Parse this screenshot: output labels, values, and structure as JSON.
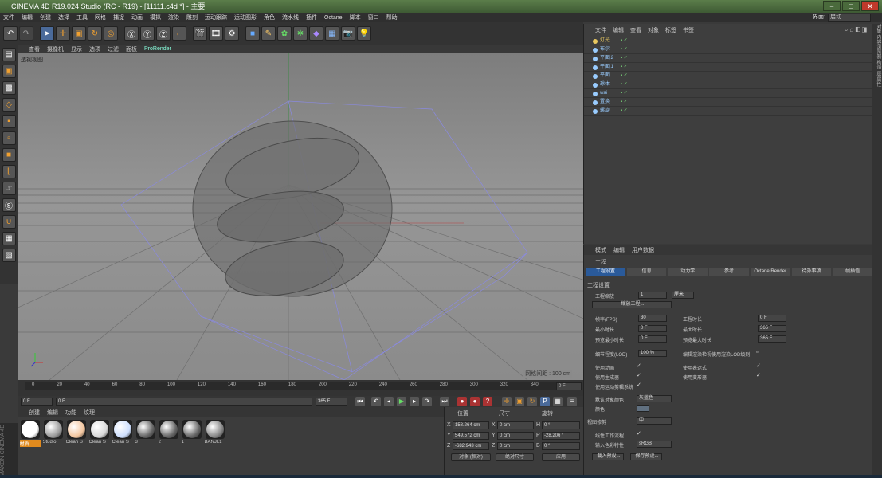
{
  "window": {
    "title": "CINEMA 4D R19.024 Studio (RC - R19) - [11111.c4d *] - 主要",
    "min": "−",
    "max": "□",
    "close": "✕"
  },
  "menubar": {
    "items": [
      "文件",
      "编辑",
      "创建",
      "选择",
      "工具",
      "网格",
      "捕捉",
      "动画",
      "模拟",
      "渲染",
      "雕刻",
      "运动跟踪",
      "运动图形",
      "角色",
      "流水线",
      "插件",
      "Octane",
      "脚本",
      "窗口",
      "帮助"
    ],
    "layout_label": "界面:",
    "layout_value": "启动"
  },
  "toolbar_icons": [
    "undo-icon",
    "redo-icon",
    "select-icon",
    "move-icon",
    "scale-icon",
    "rotate-icon",
    "live-select-icon",
    "x-axis-icon",
    "y-axis-icon",
    "z-axis-icon",
    "coord-system-icon",
    "render-view-icon",
    "render-picture-icon",
    "render-settings-icon",
    "cube-icon",
    "pen-icon",
    "subdivision-icon",
    "cloner-icon",
    "deformer-icon",
    "floor-icon",
    "camera-icon",
    "light-icon"
  ],
  "viewport": {
    "menu": [
      "查看",
      "摄像机",
      "显示",
      "选项",
      "过滤",
      "面板",
      "ProRender"
    ],
    "label": "透视视图",
    "grid_spacing": "网格间距 : 100 cm"
  },
  "timeline": {
    "ticks": [
      "0",
      "20",
      "40",
      "60",
      "80",
      "100",
      "120",
      "140",
      "160",
      "180",
      "200",
      "220",
      "240",
      "260",
      "280",
      "300",
      "320",
      "340",
      "360"
    ],
    "frame_field": "0 F"
  },
  "transport": {
    "start": "0 F",
    "current": "0 F",
    "end": "365 F",
    "end2": "365 F"
  },
  "materials": {
    "menu": [
      "创建",
      "编辑",
      "功能",
      "纹理"
    ],
    "items": [
      {
        "name": "材质",
        "color": "#ffffff",
        "selected": true
      },
      {
        "name": "Studio",
        "color": "#9a9a9a",
        "selected": false
      },
      {
        "name": "Clean S",
        "color": "#f4c7a0",
        "selected": false
      },
      {
        "name": "Clean S",
        "color": "#d8d8d8",
        "selected": false
      },
      {
        "name": "Clean S",
        "color": "#cfe0ff",
        "selected": false
      },
      {
        "name": "3",
        "color": "#666666",
        "selected": false
      },
      {
        "name": "2",
        "color": "#666666",
        "selected": false
      },
      {
        "name": "1",
        "color": "#666666",
        "selected": false
      },
      {
        "name": "BANJI.1",
        "color": "#888888",
        "selected": false
      }
    ]
  },
  "coords": {
    "headers": [
      "位置",
      "尺寸",
      "旋转"
    ],
    "rows": [
      {
        "axis": "X",
        "pos": "158.264 cm",
        "size_axis": "X",
        "size": "0 cm",
        "rot_axis": "H",
        "rot": "0 °"
      },
      {
        "axis": "Y",
        "pos": "549.572 cm",
        "size_axis": "Y",
        "size": "0 cm",
        "rot_axis": "P",
        "rot": "-28.206 °"
      },
      {
        "axis": "Z",
        "pos": "-682.943 cm",
        "size_axis": "Z",
        "size": "0 cm",
        "rot_axis": "B",
        "rot": "0 °"
      }
    ],
    "mode1": "对象 (相对)",
    "mode2": "绝对尺寸",
    "apply": "应用"
  },
  "objects": {
    "menu": [
      "文件",
      "编辑",
      "查看",
      "对象",
      "标签",
      "书签"
    ],
    "rows": [
      {
        "name": "灯光",
        "color": "#e8c860"
      },
      {
        "name": "布尔",
        "color": "#9cf"
      },
      {
        "name": "平面.2",
        "color": "#9cf"
      },
      {
        "name": "平面.1",
        "color": "#9cf"
      },
      {
        "name": "平面",
        "color": "#9cf"
      },
      {
        "name": "球体",
        "color": "#9cf"
      },
      {
        "name": "wai",
        "color": "#9cf"
      },
      {
        "name": "置换",
        "color": "#9cf"
      },
      {
        "name": "螺旋",
        "color": "#9cf"
      }
    ]
  },
  "right_strip": "对象 内容浏览器 构造 层 属性",
  "attributes": {
    "menu": [
      "模式",
      "编辑",
      "用户数据"
    ],
    "title": "工程",
    "tabs": [
      "工程设置",
      "信息",
      "动力学",
      "参考",
      "Octane Render",
      "待办事项",
      "帧插值"
    ],
    "section": "工程设置",
    "scale_label": "工程缩放",
    "scale_value": "1",
    "scale_unit": "厘米",
    "scale_btn": "缩放工程...",
    "fps_label": "帧率(FPS)",
    "fps": "30",
    "length_label": "工程时长",
    "length": "0 F",
    "min_label": "最小时长",
    "min": "0 F",
    "max_label": "最大时长",
    "max": "365 F",
    "pmin_label": "预览最小时长",
    "pmin": "0 F",
    "pmax_label": "预览最大时长",
    "pmax": "365 F",
    "lod_label": "细节程度(LOD)",
    "lod": "100 %",
    "render_lod": "编辑渲染检视使用渲染LOD级别",
    "anim_label": "使用动画",
    "expr_label": "使用表达式",
    "gen_label": "使用生成器",
    "deform_label": "使用变形器",
    "motion_label": "使用运动剪辑系统",
    "objcolor_label": "默认对象颜色",
    "objcolor": "灰蓝色",
    "color_label": "颜色",
    "view_clip": "视图修剪",
    "view_clip_val": "中",
    "linear_label": "线性工作流程",
    "input_label": "输入色彩特性",
    "input_val": "sRGB",
    "load_btn": "载入预设...",
    "save_btn": "保存预设..."
  }
}
